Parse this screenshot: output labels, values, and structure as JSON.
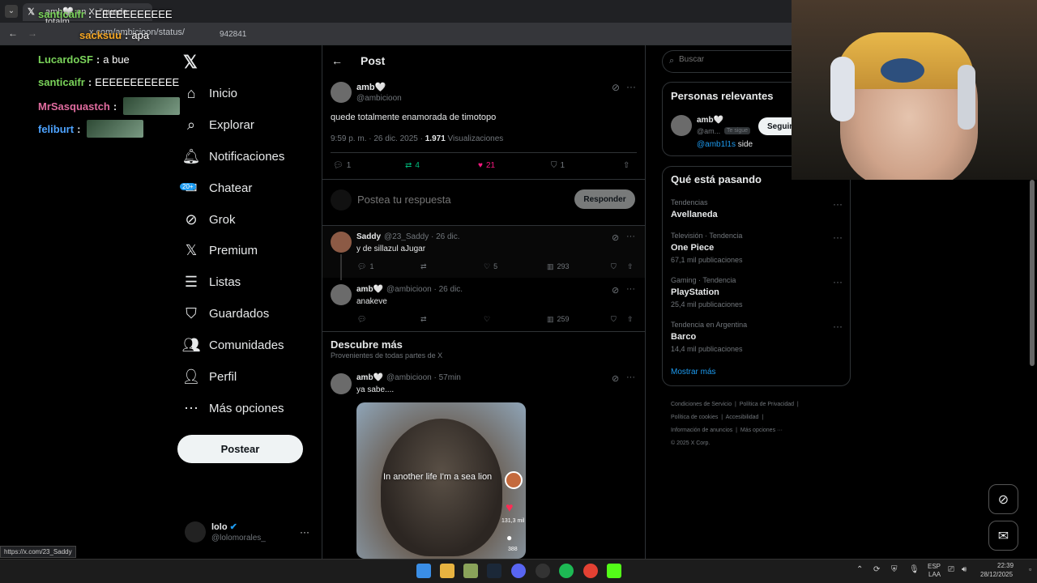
{
  "browser": {
    "tab_title": "amb🤍 en X: \"quede totalm",
    "url_fragment": "x.com/ambicioon/status/",
    "url_tail": "942841",
    "status_url": "https://x.com/23_Saddy"
  },
  "chat": [
    {
      "user": "santicaifr",
      "message": "EEEEEEEEEEE",
      "color": "#7ad35a"
    },
    {
      "user": "sacksuu",
      "message": "apa",
      "color": "#f5a623"
    },
    {
      "user": "LucardoSF",
      "message": "a bue",
      "color": "#7ad35a"
    },
    {
      "user": "santicaifr",
      "message": "EEEEEEEEEEEE",
      "color": "#7ad35a"
    },
    {
      "user": "MrSasquastch",
      "message": "",
      "color": "#e06c9f"
    },
    {
      "user": "feliburt",
      "message": "",
      "color": "#4da3ff"
    }
  ],
  "nav": {
    "items": [
      {
        "label": "Inicio",
        "icon": "home-icon"
      },
      {
        "label": "Explorar",
        "icon": "search-icon"
      },
      {
        "label": "Notificaciones",
        "icon": "bell-icon"
      },
      {
        "label": "Chatear",
        "icon": "chat-icon",
        "badge": "20+"
      },
      {
        "label": "Grok",
        "icon": "grok-icon"
      },
      {
        "label": "Premium",
        "icon": "x-icon"
      },
      {
        "label": "Listas",
        "icon": "list-icon"
      },
      {
        "label": "Guardados",
        "icon": "bookmark-icon"
      },
      {
        "label": "Comunidades",
        "icon": "communities-icon"
      },
      {
        "label": "Perfil",
        "icon": "profile-icon"
      },
      {
        "label": "Más opciones",
        "icon": "more-icon"
      }
    ],
    "post_button": "Postear",
    "account_name": "lolo",
    "account_handle": "@lolomorales_"
  },
  "post": {
    "header": "Post",
    "author": "amb🤍",
    "handle": "@ambicioon",
    "text": "quede totalmente enamorada de timotopo",
    "time": "9:59 p. m. · 26 dic. 2025 ·",
    "views": "1.971",
    "views_label": "Visualizaciones",
    "replies": "1",
    "reposts": "4",
    "likes": "21",
    "bookmarks": "1",
    "reply_placeholder": "Postea tu respuesta",
    "reply_button": "Responder"
  },
  "replies": [
    {
      "author": "Saddy",
      "meta": "@23_Saddy · 26 dic.",
      "text": "y de sillazul aJugar",
      "replies": "1",
      "likes": "5",
      "views": "293"
    },
    {
      "author": "amb🤍",
      "meta": "@ambicioon · 26 dic.",
      "text": "anakeve",
      "replies": "",
      "likes": "",
      "views": "259"
    }
  ],
  "discover": {
    "title": "Descubre más",
    "subtitle": "Provenientes de todas partes de X",
    "author": "amb🤍",
    "meta": "@ambicioon · 57min",
    "text": "ya sabe....",
    "video_caption": "In another life I'm a sea lion",
    "video_likes": "131,3 mil",
    "video_comments": "388"
  },
  "right": {
    "search_placeholder": "Buscar",
    "relevant_title": "Personas relevantes",
    "relevant_name": "amb🤍",
    "relevant_handle": "@am...",
    "follows_you": "Te sigue",
    "follow_button": "Seguir",
    "relevant_bio_mention": "@amb1l1s",
    "relevant_bio_text": "side",
    "trends_title": "Qué está pasando",
    "trends": [
      {
        "category": "Tendencias",
        "name": "Avellaneda",
        "count": ""
      },
      {
        "category": "Televisión · Tendencia",
        "name": "One Piece",
        "count": "67,1 mil publicaciones"
      },
      {
        "category": "Gaming · Tendencia",
        "name": "PlayStation",
        "count": "25,4 mil publicaciones"
      },
      {
        "category": "Tendencia en Argentina",
        "name": "Barco",
        "count": "14,4 mil publicaciones"
      }
    ],
    "show_more": "Mostrar más",
    "footer": [
      "Condiciones de Servicio",
      "Política de Privacidad",
      "Política de cookies",
      "Accesibilidad",
      "Información de anuncios",
      "Más opciones ···",
      "© 2025 X Corp."
    ]
  },
  "taskbar": {
    "lang": "ESP",
    "lang2": "LAA",
    "time": "22:39",
    "date": "28/12/2025"
  },
  "colors": {
    "accent": "#1d9bf0",
    "like": "#f91880",
    "repost": "#00ba7c"
  }
}
